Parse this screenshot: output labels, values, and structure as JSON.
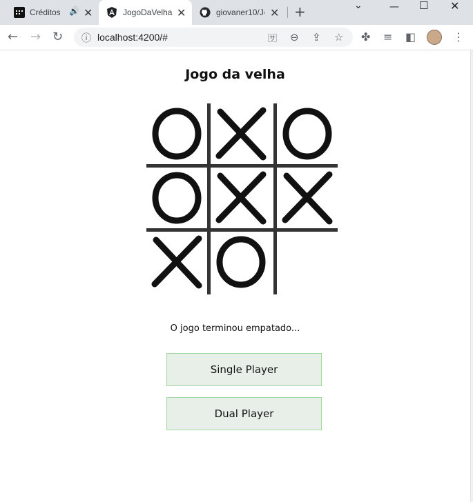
{
  "browser": {
    "tabs": [
      {
        "title": "Créditos",
        "favicon": "deezer-icon",
        "audio": true
      },
      {
        "title": "JogoDaVelha",
        "favicon": "angular-icon",
        "active": true
      },
      {
        "title": "giovaner10/Jo",
        "favicon": "github-icon"
      }
    ],
    "new_tab_symbol": "+",
    "url": "localhost:4200/#"
  },
  "game": {
    "title": "Jogo da velha",
    "board": [
      "O",
      "X",
      "O",
      "O",
      "X",
      "X",
      "X",
      "O",
      ""
    ],
    "status": "O jogo terminou empatado...",
    "buttons": {
      "single": "Single Player",
      "dual": "Dual Player"
    }
  },
  "colors": {
    "tabstrip": "#dee1e6",
    "button_bg": "#e8efe8",
    "button_border": "#9ed89e",
    "grid": "#333333"
  }
}
